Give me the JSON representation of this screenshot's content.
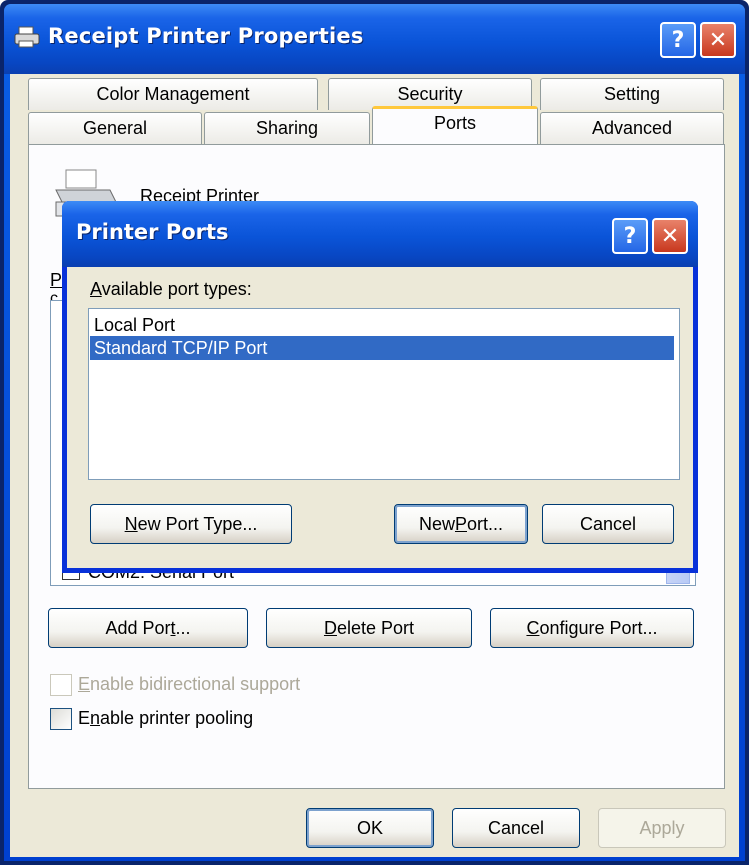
{
  "main_window": {
    "title": "Receipt Printer Properties",
    "help_symbol": "?",
    "close_symbol": "✕"
  },
  "tabs": {
    "row1": [
      "Color Management",
      "Security",
      "Setting"
    ],
    "row2": [
      "General",
      "Sharing",
      "Ports",
      "Advanced"
    ],
    "active": "Ports"
  },
  "ports_page": {
    "printer_name": "Receipt Printer",
    "partial_label_1": "P",
    "partial_label_2": "c",
    "list_row": "COM2:   Serial Port",
    "add_port": {
      "pre": "Add Por",
      "key": "t",
      "post": "..."
    },
    "delete_port": {
      "pre": "",
      "key": "D",
      "post": "elete Port"
    },
    "configure_port": {
      "pre": "",
      "key": "C",
      "post": "onfigure Port..."
    },
    "bidirectional": {
      "pre": "",
      "key": "E",
      "post": "nable bidirectional support",
      "enabled": false,
      "checked": false
    },
    "pooling": {
      "pre": "E",
      "key": "n",
      "post": "able printer pooling",
      "enabled": true,
      "checked": false
    }
  },
  "bottom_buttons": {
    "ok": "OK",
    "cancel": "Cancel",
    "apply": "Apply"
  },
  "dialog": {
    "title": "Printer Ports",
    "label": {
      "pre": "",
      "key": "A",
      "post": "vailable port types:"
    },
    "port_types": [
      "Local Port",
      "Standard TCP/IP Port"
    ],
    "selected_index": 1,
    "new_port_type": {
      "pre": "",
      "key": "N",
      "post": "ew Port Type..."
    },
    "new_port": {
      "pre": "New ",
      "key": "P",
      "post": "ort..."
    },
    "cancel": "Cancel"
  },
  "colors": {
    "title_bar": "#0a54d8",
    "client_bg": "#ece9d8",
    "selection": "#316ac5",
    "active_tab_accent": "#ffc83c"
  }
}
